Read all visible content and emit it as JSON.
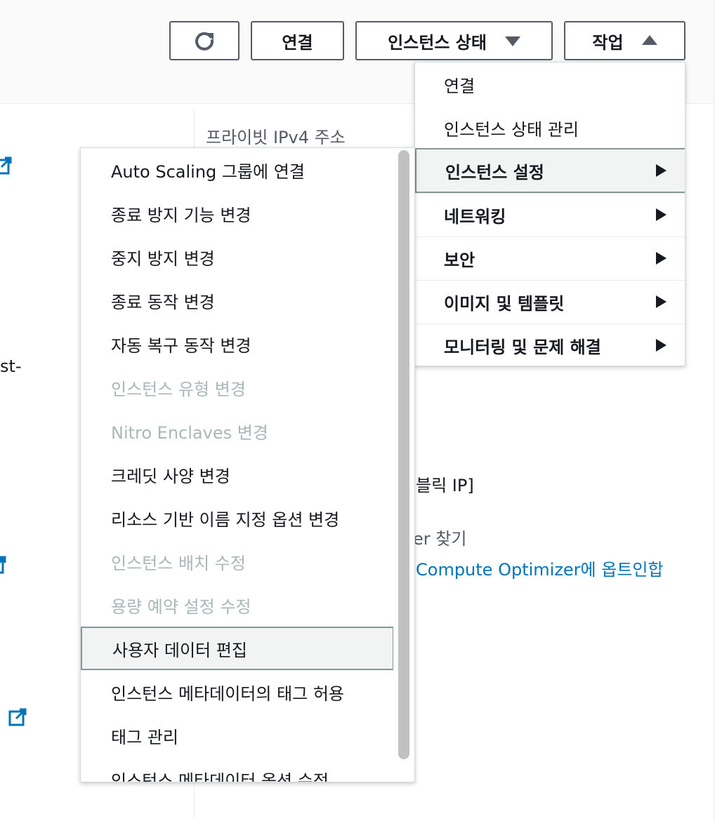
{
  "toolbar": {
    "refresh_icon": "refresh-icon",
    "connect_label": "연결",
    "instance_state_label": "인스턴스 상태",
    "actions_label": "작업"
  },
  "background": {
    "private_ipv4_label": "프라이빗 IPv4 주소",
    "truncated_left_text": "st-",
    "public_ip_partial": "블릭 IP]",
    "finder_partial": "er 찾기",
    "compute_optimizer_link": "Compute Optimizer에 옵트인합"
  },
  "actions_menu": {
    "items": [
      {
        "label": "연결",
        "bold": false,
        "submenu": false
      },
      {
        "label": "인스턴스 상태 관리",
        "bold": false,
        "submenu": false
      },
      {
        "label": "인스턴스 설정",
        "bold": true,
        "submenu": true,
        "active": true
      },
      {
        "label": "네트워킹",
        "bold": true,
        "submenu": true
      },
      {
        "label": "보안",
        "bold": true,
        "submenu": true
      },
      {
        "label": "이미지 및 템플릿",
        "bold": true,
        "submenu": true
      },
      {
        "label": "모니터링 및 문제 해결",
        "bold": true,
        "submenu": true
      }
    ]
  },
  "instance_settings_menu": {
    "items": [
      {
        "label": "Auto Scaling 그룹에 연결",
        "disabled": false
      },
      {
        "label": "종료 방지 기능 변경",
        "disabled": false
      },
      {
        "label": "중지 방지 변경",
        "disabled": false
      },
      {
        "label": "종료 동작 변경",
        "disabled": false
      },
      {
        "label": "자동 복구 동작 변경",
        "disabled": false
      },
      {
        "label": "인스턴스 유형 변경",
        "disabled": true
      },
      {
        "label": "Nitro Enclaves 변경",
        "disabled": true
      },
      {
        "label": "크레딧 사양 변경",
        "disabled": false
      },
      {
        "label": "리소스 기반 이름 지정 옵션 변경",
        "disabled": false
      },
      {
        "label": "인스턴스 배치 수정",
        "disabled": true
      },
      {
        "label": "용량 예약 설정 수정",
        "disabled": true
      },
      {
        "label": "사용자 데이터 편집",
        "disabled": false,
        "hover": true
      },
      {
        "label": "인스턴스 메타데이터의 태그 허용",
        "disabled": false
      },
      {
        "label": "태그 관리",
        "disabled": false
      },
      {
        "label": "인스턴스 메타데이터 옵션 수정",
        "disabled": false
      }
    ]
  },
  "colors": {
    "link": "#0073bb",
    "disabled_text": "#aab7b8",
    "border": "#545b64",
    "hover_bg": "#f2f3f3"
  }
}
